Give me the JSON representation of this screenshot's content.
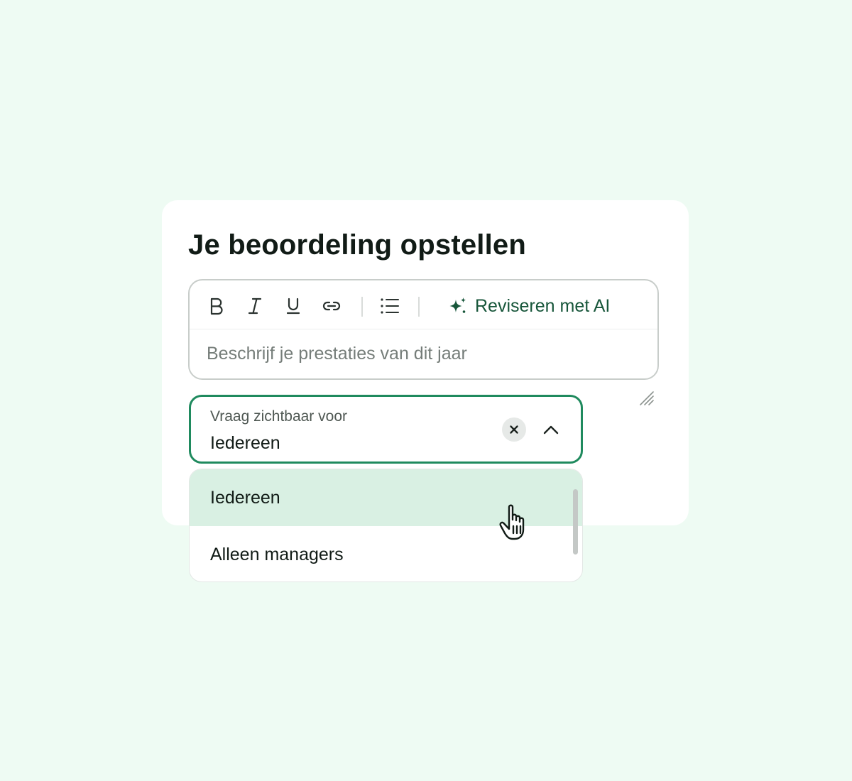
{
  "card": {
    "title": "Je beoordeling opstellen"
  },
  "editor": {
    "toolbar": {
      "bold_icon": "bold-icon",
      "italic_icon": "italic-icon",
      "underline_icon": "underline-icon",
      "link_icon": "link-icon",
      "list_icon": "bulleted-list-icon",
      "ai_icon": "sparkle-icon",
      "ai_label": "Reviseren met AI"
    },
    "placeholder": "Beschrijf je prestaties van dit jaar"
  },
  "visibility_select": {
    "label": "Vraag zichtbaar voor",
    "value": "Iedereen",
    "clear_icon": "close-icon",
    "toggle_icon": "chevron-up-icon",
    "options": [
      {
        "label": "Iedereen",
        "highlighted": true
      },
      {
        "label": "Alleen managers",
        "highlighted": false
      }
    ]
  },
  "colors": {
    "background": "#eefbf3",
    "accent": "#1f8a5e",
    "ai_text": "#17563a",
    "option_highlight": "#d9f0e3"
  }
}
